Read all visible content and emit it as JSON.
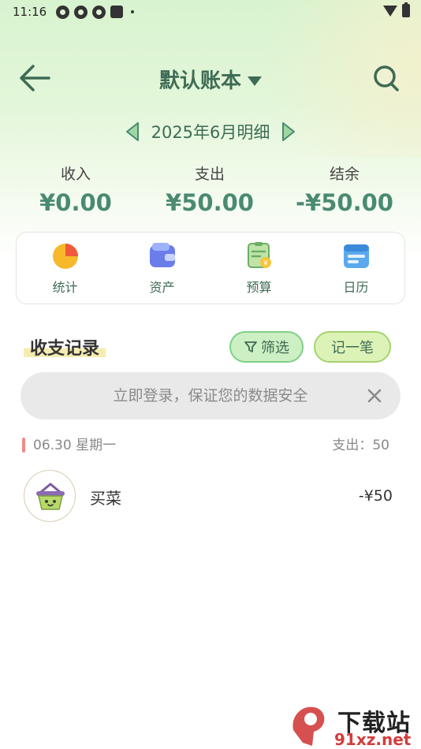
{
  "status_bar": {
    "time": "11:16"
  },
  "header": {
    "title": "默认账本"
  },
  "month_nav": {
    "label": "2025年6月明细"
  },
  "summary": [
    {
      "label": "收入",
      "value": "¥0.00"
    },
    {
      "label": "支出",
      "value": "¥50.00"
    },
    {
      "label": "结余",
      "value": "-¥50.00"
    }
  ],
  "tools": [
    {
      "label": "统计",
      "icon": "pie-chart-icon"
    },
    {
      "label": "资产",
      "icon": "wallet-icon"
    },
    {
      "label": "预算",
      "icon": "budget-icon"
    },
    {
      "label": "日历",
      "icon": "calendar-icon"
    }
  ],
  "records": {
    "title": "收支记录",
    "filter_label": "筛选",
    "add_label": "记一笔"
  },
  "login_banner": {
    "text": "立即登录，保证您的数据安全"
  },
  "day_group": {
    "date": "06.30 星期一",
    "total": "支出：50"
  },
  "record_items": [
    {
      "name": "买菜",
      "amount": "-¥50",
      "icon": "basket-icon"
    }
  ],
  "watermark": {
    "text": "下载站",
    "url": "91xz.net"
  },
  "colors": {
    "accent": "#3e6b55",
    "value_green": "#4a8a72",
    "bg_top": "#d8f3cf",
    "filter_bg": "#ccefc3",
    "add_bg": "#ddf2b7"
  }
}
